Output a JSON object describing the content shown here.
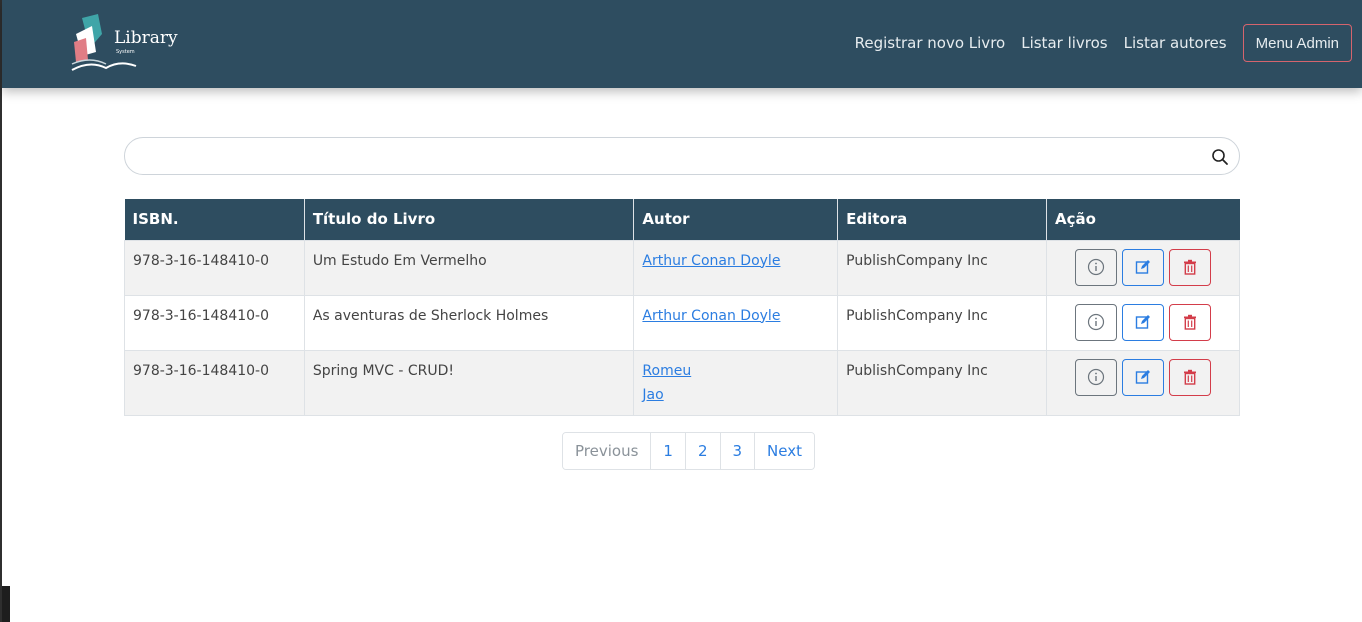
{
  "brand": {
    "name": "Library",
    "sub": "System"
  },
  "nav": {
    "links": [
      "Registrar novo Livro",
      "Listar livros",
      "Listar autores"
    ],
    "admin_button": "Menu Admin"
  },
  "search": {
    "placeholder": "",
    "value": ""
  },
  "table": {
    "headers": [
      "ISBN.",
      "Título do Livro",
      "Autor",
      "Editora",
      "Ação"
    ],
    "rows": [
      {
        "isbn": "978-3-16-148410-0",
        "title": "Um Estudo Em Vermelho",
        "authors": [
          "Arthur Conan Doyle"
        ],
        "publisher": "PublishCompany Inc"
      },
      {
        "isbn": "978-3-16-148410-0",
        "title": "As aventuras de Sherlock Holmes",
        "authors": [
          "Arthur Conan Doyle"
        ],
        "publisher": "PublishCompany Inc"
      },
      {
        "isbn": "978-3-16-148410-0",
        "title": "Spring MVC - CRUD!",
        "authors": [
          "Romeu",
          "Jao"
        ],
        "publisher": "PublishCompany Inc"
      }
    ]
  },
  "pagination": {
    "previous": "Previous",
    "pages": [
      "1",
      "2",
      "3"
    ],
    "next": "Next"
  },
  "colors": {
    "navbar": "#2e4d60",
    "link": "#2b7de1",
    "danger": "#d33d4a",
    "admin_border": "#d5646d"
  },
  "icons": {
    "search": "search-icon",
    "info": "info-icon",
    "edit": "edit-icon",
    "delete": "trash-icon"
  }
}
